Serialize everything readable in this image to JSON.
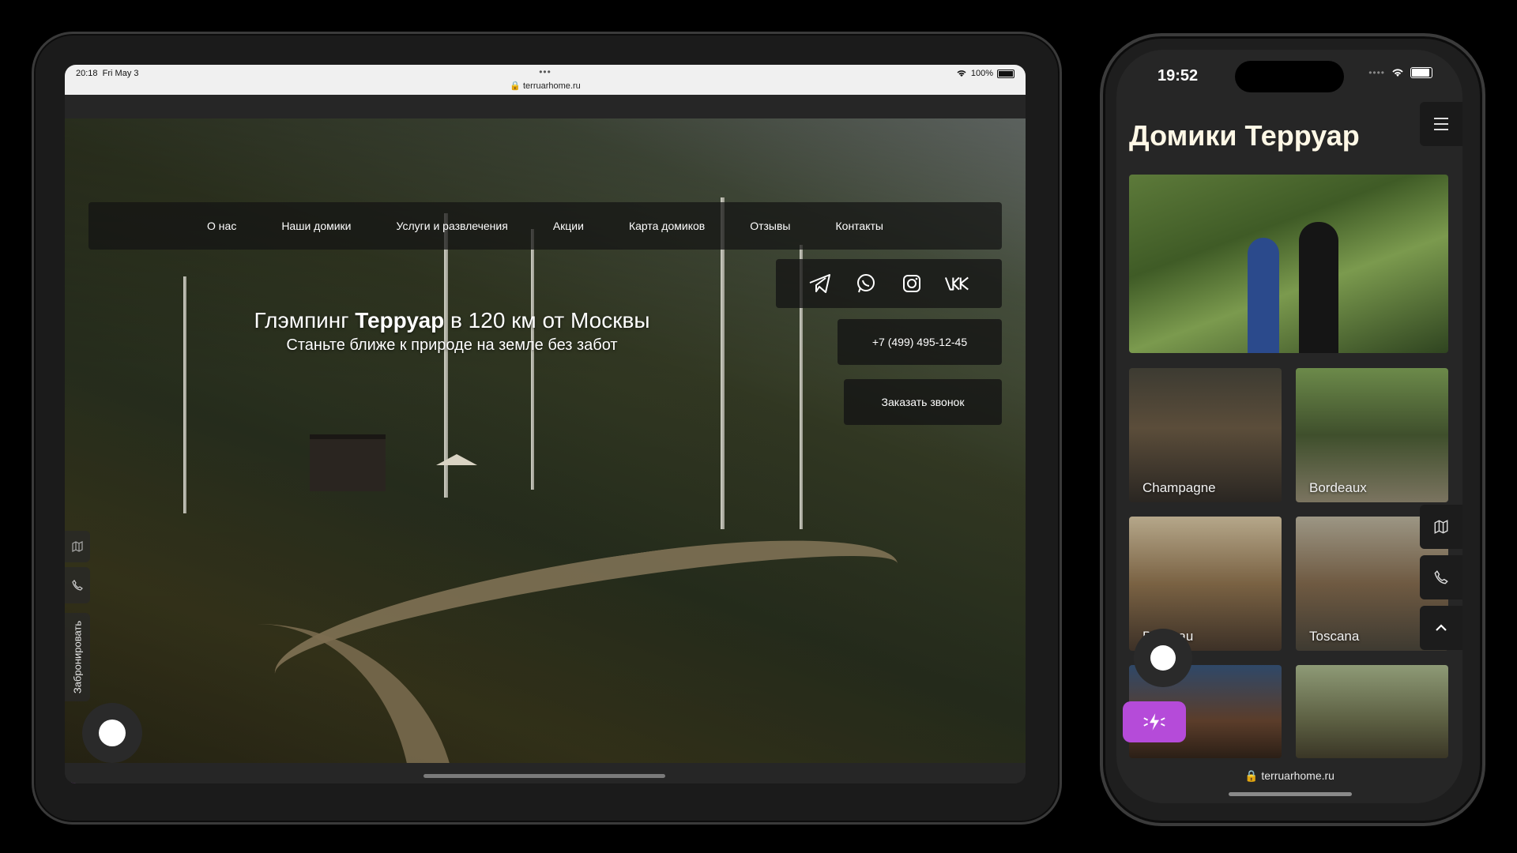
{
  "tablet": {
    "status": {
      "time": "20:18",
      "date": "Fri May 3",
      "battery": "100%",
      "url": "terruarhome.ru"
    },
    "nav": [
      "О нас",
      "Наши домики",
      "Услуги и развлечения",
      "Акции",
      "Карта домиков",
      "Отзывы",
      "Контакты"
    ],
    "social_icons": [
      "telegram-icon",
      "whatsapp-icon",
      "instagram-icon",
      "vk-icon"
    ],
    "phone": "+7 (499) 495-12-45",
    "call_button": "Заказать звонок",
    "headline_pre": "Глэмпинг ",
    "headline_bold": "Терруар",
    "headline_post": " в 120 км от Москвы",
    "subheadline": "Станьте ближе к природе на земле без забот",
    "book_tab": "Забронировать"
  },
  "phone": {
    "status": {
      "time": "19:52"
    },
    "title": "Домики Терруар",
    "houses": [
      "Champagne",
      "Bordeaux",
      "Bordeau",
      "Toscana"
    ],
    "url": "terruarhome.ru"
  },
  "colors": {
    "accent": "#b54bd9",
    "background": "#000000",
    "panel": "#262626"
  }
}
